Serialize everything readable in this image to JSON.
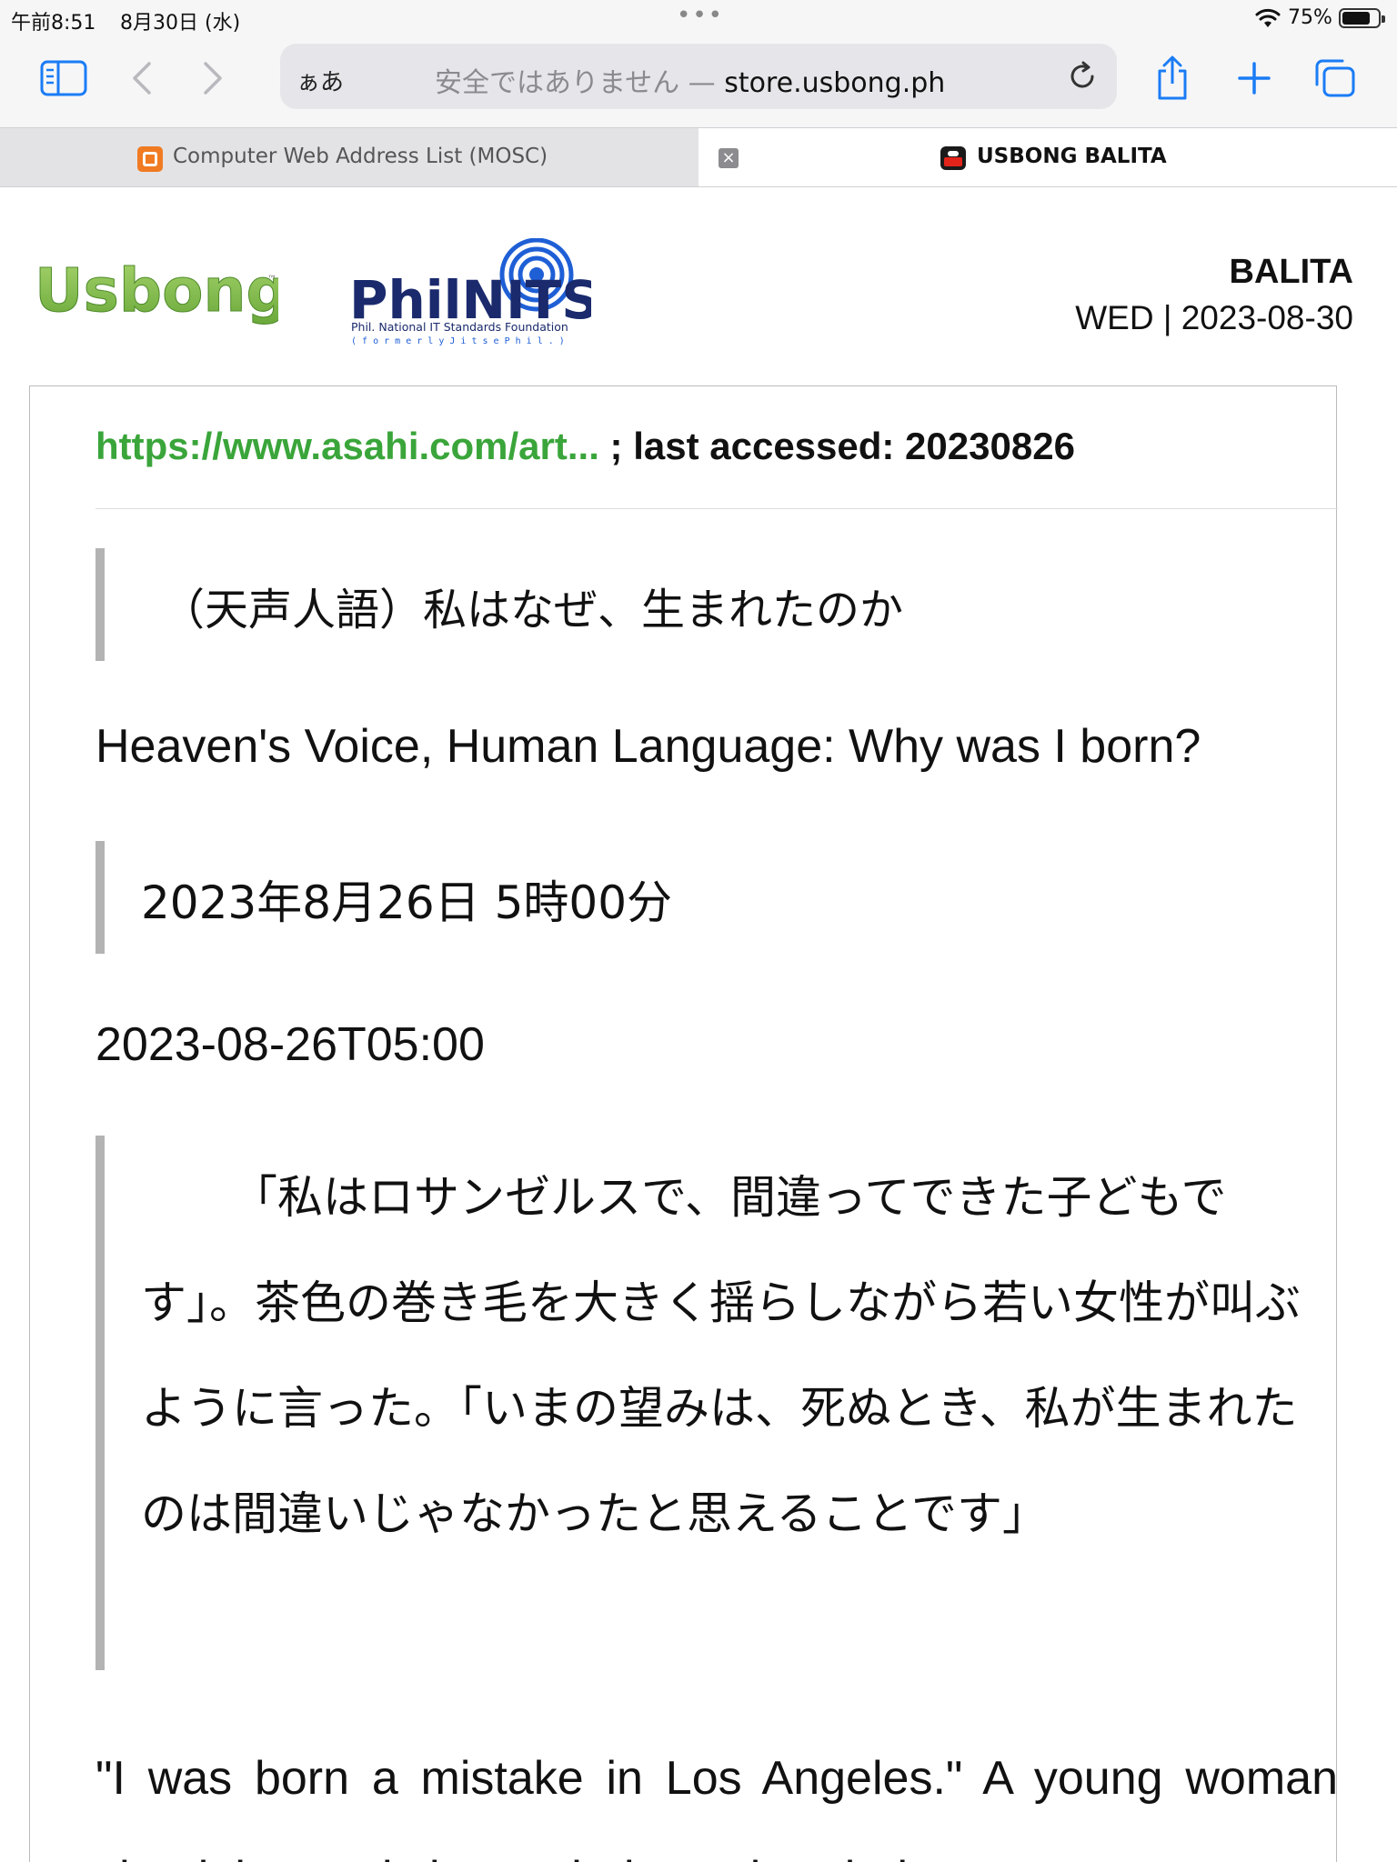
{
  "status_bar": {
    "time": "午前8:51",
    "date": "8月30日 (水)",
    "dots": "•••",
    "battery_pct": "75%"
  },
  "toolbar": {
    "aa_label": "ぁあ",
    "insecure_label": "安全ではありません — ",
    "host": "store.usbong.ph"
  },
  "tabs": [
    {
      "title": "Computer Web Address List (MOSC)",
      "active": false
    },
    {
      "title": "USBONG BALITA",
      "active": true
    }
  ],
  "header": {
    "usbong_logo_text": "Usbong",
    "usbong_tm": "™",
    "philnits_logo_text": "PhilNITS",
    "philnits_sub1": "Phil. National IT Standards Foundation",
    "philnits_sub2": "( f o r m e r l y   J i t s e   P h i l . )",
    "section": "BALITA",
    "dateline": "WED | 2023-08-30"
  },
  "article": {
    "source_link": "https://www.asahi.com/art...",
    "source_rest": " ; last accessed: 20230826",
    "jp_title": "（天声人語）私はなぜ、生まれたのか",
    "en_title": "Heaven's Voice, Human Language: Why was I born?",
    "jp_timestamp": "2023年8月26日 5時00分",
    "iso_timestamp": "2023-08-26T05:00",
    "jp_paragraph": "「私はロサンゼルスで、間違ってできた子どもです」。茶色の巻き毛を大きく揺らしながら若い女性が叫ぶように言った。「いまの望みは、死ぬとき、私が生まれたのは間違いじゃなかったと思えることです」",
    "en_paragraph": "\"I was born a mistake in Los Angeles.\" A young woman shook her curly brown hair as she tried to"
  },
  "colors": {
    "link_green": "#3aa53a",
    "accent_blue": "#1a7cf5",
    "usbong_green": "#7ab648",
    "philnits_navy": "#1a2a6c",
    "philnits_blue": "#1f5fd6"
  }
}
